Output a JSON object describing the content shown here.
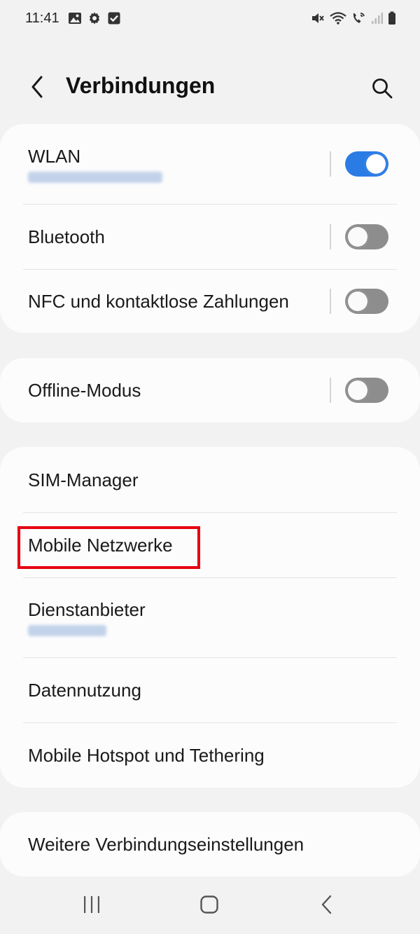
{
  "status_bar": {
    "time": "11:41",
    "left_icons": [
      "image-icon",
      "gear-icon",
      "checkbox-icon"
    ],
    "right_icons": [
      "mute-icon",
      "wifi-icon",
      "wifi-call-icon",
      "signal-icon",
      "battery-icon"
    ]
  },
  "header": {
    "title": "Verbindungen",
    "back_icon": "chevron-left-icon",
    "search_icon": "search-icon"
  },
  "groups": [
    {
      "items": [
        {
          "label": "WLAN",
          "toggle": true,
          "state": "on",
          "subtitle_blurred": true
        },
        {
          "label": "Bluetooth",
          "toggle": true,
          "state": "off"
        },
        {
          "label": "NFC und kontaktlose Zahlungen",
          "toggle": true,
          "state": "off"
        }
      ]
    },
    {
      "items": [
        {
          "label": "Offline-Modus",
          "toggle": true,
          "state": "off"
        }
      ]
    },
    {
      "items": [
        {
          "label": "SIM-Manager"
        },
        {
          "label": "Mobile Netzwerke",
          "highlighted": true
        },
        {
          "label": "Dienstanbieter",
          "subtitle_blurred": true
        },
        {
          "label": "Datennutzung"
        },
        {
          "label": "Mobile Hotspot und Tethering"
        }
      ]
    },
    {
      "items": [
        {
          "label": "Weitere Verbindungseinstellungen"
        }
      ]
    }
  ],
  "nav_bar": {
    "icons": [
      "recent-apps-icon",
      "home-icon",
      "back-icon"
    ]
  },
  "colors": {
    "accent": "#2b7be5",
    "highlight": "#e60012",
    "background": "#f2f2f2",
    "card": "#fcfcfc"
  }
}
